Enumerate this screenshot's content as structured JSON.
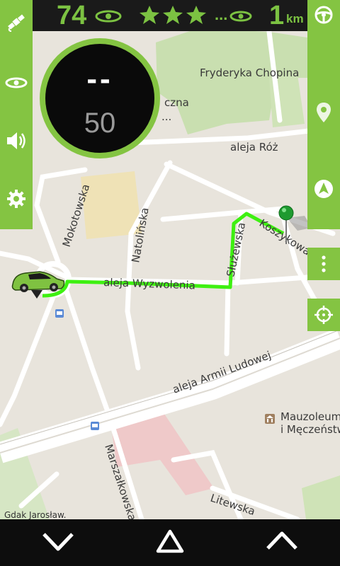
{
  "status_bar": {
    "speed": "74",
    "stars_count": 3,
    "distance_value": "1",
    "distance_unit": "km",
    "ellipsis": "...",
    "accent_color": "#7cc242"
  },
  "speedometer": {
    "current_speed": "--",
    "speed_limit": "50"
  },
  "left_toolbar": {
    "items": [
      {
        "icon": "satellite-icon"
      },
      {
        "icon": "gps-signal-icon"
      },
      {
        "icon": "speaker-icon"
      },
      {
        "icon": "gear-icon"
      }
    ]
  },
  "right_toolbar": {
    "items": [
      {
        "icon": "steering-wheel-icon"
      },
      {
        "icon": "location-pin-icon"
      },
      {
        "icon": "navigation-arrow-icon"
      }
    ],
    "more_icon": "more-vertical-icon",
    "locate_icon": "crosshair-icon"
  },
  "map": {
    "streets": {
      "chopina": "Fryderyka Chopina",
      "roz": "aleja Róż",
      "mokotowska": "Mokotowska",
      "natolinska": "Natolińska",
      "wyzwolenia": "aleja Wyzwolenia",
      "sluzewska": "Służewska",
      "koszykowa": "Koszykowa",
      "armii_ludowej": "aleja Armii Ludowej",
      "marszalkowska": "Marszałkowska",
      "litewska": "Litewska",
      "czna": "czna",
      "dots": "...",
      "mauzoleum_1": "Mauzoleum",
      "mauzoleum_2": "i Męczeństw"
    },
    "attribution": "Gdak Jarosław."
  },
  "bottom_bar": {
    "items": [
      {
        "icon": "chevron-down-icon"
      },
      {
        "icon": "triangle-up-icon"
      },
      {
        "icon": "chevron-up-icon"
      }
    ]
  }
}
